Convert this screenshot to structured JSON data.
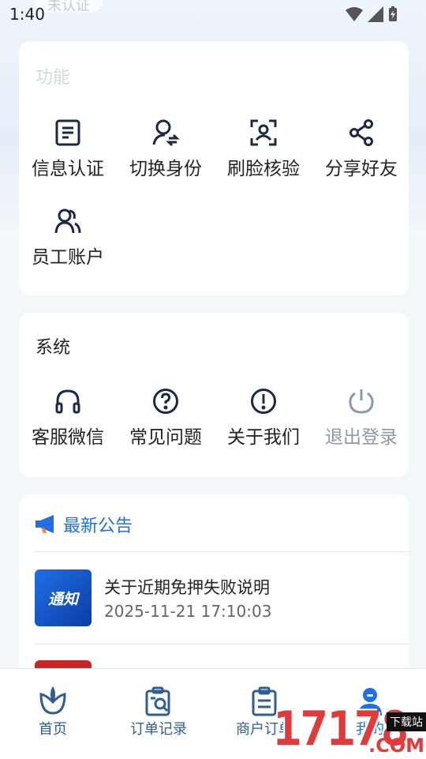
{
  "status_bar": {
    "time": "1:40",
    "ghost_label": "未认证"
  },
  "colors": {
    "accent": "#1f6fe6",
    "tab_blue": "#2f5e93",
    "watermark_red": "#e23a3a"
  },
  "functions": {
    "title": "功能",
    "items": [
      {
        "label": "信息认证",
        "icon": "document-icon"
      },
      {
        "label": "切换身份",
        "icon": "user-switch-icon"
      },
      {
        "label": "刷脸核验",
        "icon": "face-scan-icon"
      },
      {
        "label": "分享好友",
        "icon": "share-icon"
      },
      {
        "label": "员工账户",
        "icon": "users-icon"
      }
    ]
  },
  "system": {
    "title": "系统",
    "items": [
      {
        "label": "客服微信",
        "icon": "headset-icon"
      },
      {
        "label": "常见问题",
        "icon": "question-icon"
      },
      {
        "label": "关于我们",
        "icon": "info-exclamation-icon"
      },
      {
        "label": "退出登录",
        "icon": "power-icon"
      }
    ]
  },
  "announcements": {
    "title": "最新公告",
    "items": [
      {
        "thumb_text": "通知",
        "title": "关于近期免押失败说明",
        "date": "2025-11-21 17:10:03"
      }
    ]
  },
  "tabs": [
    {
      "label": "首页",
      "icon": "home-leaf-icon"
    },
    {
      "label": "订单记录",
      "icon": "order-record-icon"
    },
    {
      "label": "商户订单",
      "icon": "clipboard-icon"
    },
    {
      "label": "我的",
      "icon": "profile-icon"
    }
  ],
  "watermark": {
    "number": "17178",
    "site": "下载站",
    "domain": ".COM"
  }
}
